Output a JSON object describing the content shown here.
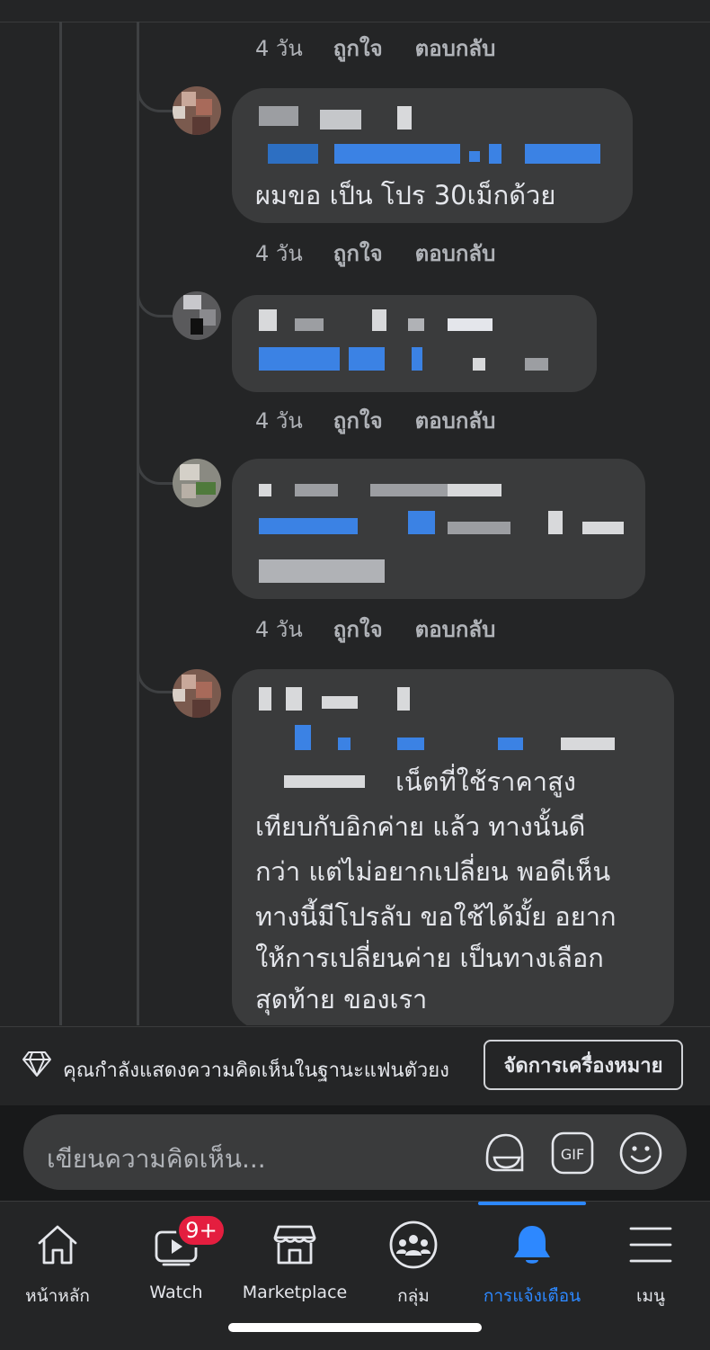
{
  "comments": [
    {
      "age": "4 วัน",
      "like": "ถูกใจ",
      "reply": "ตอบกลับ"
    },
    {
      "body": "ผมขอ เป็น โปร 30เม็กด้วย",
      "age": "4 วัน",
      "like": "ถูกใจ",
      "reply": "ตอบกลับ"
    },
    {
      "age": "4 วัน",
      "like": "ถูกใจ",
      "reply": "ตอบกลับ"
    },
    {
      "age": "4 วัน",
      "like": "ถูกใจ",
      "reply": "ตอบกลับ"
    },
    {
      "body_lines": [
        "เน็ตที่ใช้ราคาสูง",
        "เทียบกับอิกค่าย แล้ว ทางนั้นดี",
        "กว่า แต่ไม่อยากเปลี่ยน พอดีเห็น",
        "ทางนี้มีโปรลับ ขอใช้ได้มั้ย อยาก",
        "ให้การเปลี่ยนค่าย เป็นทางเลือก",
        "สุดท้าย ของเรา"
      ]
    }
  ],
  "notice": {
    "text": "คุณกำลังแสดงความคิดเห็นในฐานะแฟนตัวยง",
    "button": "จัดการเครื่องหมาย",
    "icon": "diamond-icon"
  },
  "composer": {
    "placeholder": "เขียนความคิดเห็น...",
    "gif_label": "GIF"
  },
  "tabs": [
    {
      "label": "หน้าหลัก",
      "icon": "home-icon"
    },
    {
      "label": "Watch",
      "icon": "watch-icon",
      "badge": "9+"
    },
    {
      "label": "Marketplace",
      "icon": "marketplace-icon"
    },
    {
      "label": "กลุ่ม",
      "icon": "groups-icon"
    },
    {
      "label": "การแจ้งเตือน",
      "icon": "bell-icon",
      "active": true
    },
    {
      "label": "เมนู",
      "icon": "menu-icon"
    }
  ],
  "colors": {
    "accent": "#2d88ff",
    "badge": "#e41e3f",
    "bubble": "#3a3b3c",
    "background": "#242526"
  }
}
